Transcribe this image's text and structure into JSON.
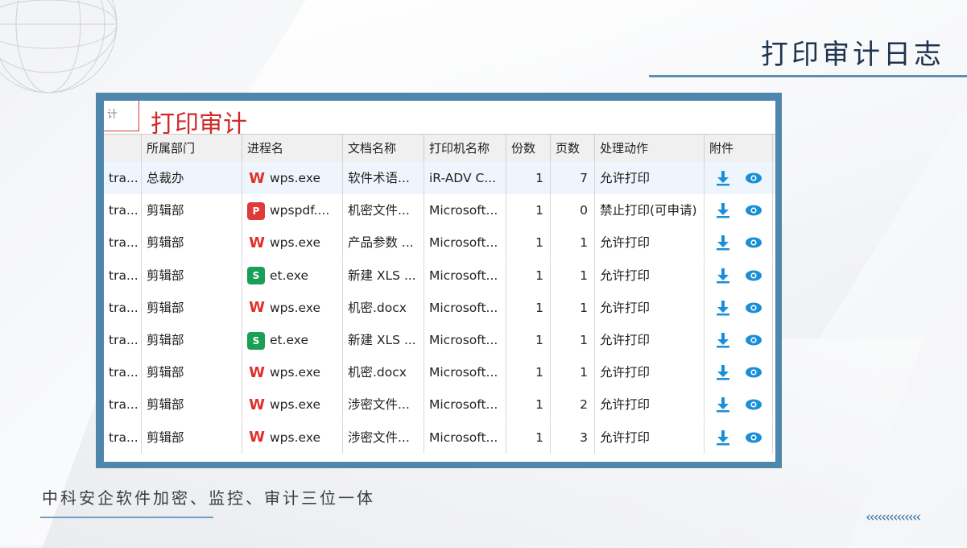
{
  "slide": {
    "title": "打印审计日志",
    "slogan": "中科安企软件加密、监控、审计三位一体",
    "chevrons": "‹‹‹‹‹‹‹‹‹‹‹‹‹‹"
  },
  "window": {
    "tab_stub": "计",
    "overlay_title": "打印审计"
  },
  "table": {
    "columns": [
      "",
      "所属部门",
      "进程名",
      "文档名称",
      "打印机名称",
      "份数",
      "页数",
      "处理动作",
      "附件",
      ""
    ],
    "rows": [
      {
        "user": "tra...",
        "dept": "总裁办",
        "icon": "wps-icon",
        "process": "wps.exe",
        "doc": "软件术语...",
        "printer": "iR-ADV C...",
        "copies": "1",
        "pages": "7",
        "action": "允许打印"
      },
      {
        "user": "tra...",
        "dept": "剪辑部",
        "icon": "wpspdf-icon",
        "process": "wpspdf....",
        "doc": "机密文件...",
        "printer": "Microsoft...",
        "copies": "1",
        "pages": "0",
        "action": "禁止打印(可申请)"
      },
      {
        "user": "tra...",
        "dept": "剪辑部",
        "icon": "wps-icon",
        "process": "wps.exe",
        "doc": "产品参数 ...",
        "printer": "Microsoft...",
        "copies": "1",
        "pages": "1",
        "action": "允许打印"
      },
      {
        "user": "tra...",
        "dept": "剪辑部",
        "icon": "et-icon",
        "process": "et.exe",
        "doc": "新建 XLS ...",
        "printer": "Microsoft...",
        "copies": "1",
        "pages": "1",
        "action": "允许打印"
      },
      {
        "user": "tra...",
        "dept": "剪辑部",
        "icon": "wps-icon",
        "process": "wps.exe",
        "doc": "机密.docx",
        "printer": "Microsoft...",
        "copies": "1",
        "pages": "1",
        "action": "允许打印"
      },
      {
        "user": "tra...",
        "dept": "剪辑部",
        "icon": "et-icon",
        "process": "et.exe",
        "doc": "新建 XLS ...",
        "printer": "Microsoft...",
        "copies": "1",
        "pages": "1",
        "action": "允许打印"
      },
      {
        "user": "tra...",
        "dept": "剪辑部",
        "icon": "wps-icon",
        "process": "wps.exe",
        "doc": "机密.docx",
        "printer": "Microsoft...",
        "copies": "1",
        "pages": "1",
        "action": "允许打印"
      },
      {
        "user": "tra...",
        "dept": "剪辑部",
        "icon": "wps-icon",
        "process": "wps.exe",
        "doc": "涉密文件...",
        "printer": "Microsoft...",
        "copies": "1",
        "pages": "2",
        "action": "允许打印"
      },
      {
        "user": "tra...",
        "dept": "剪辑部",
        "icon": "wps-icon",
        "process": "wps.exe",
        "doc": "涉密文件...",
        "printer": "Microsoft...",
        "copies": "1",
        "pages": "3",
        "action": "允许打印"
      }
    ],
    "tail_char": "2",
    "icon_glyphs": {
      "wps-icon": "W",
      "wpspdf-icon": "P",
      "et-icon": "S"
    }
  },
  "colors": {
    "frame": "#4f86ab",
    "title": "#1f3450",
    "overlay_title": "#d02a2a",
    "action_icon": "#1b8fd6"
  }
}
